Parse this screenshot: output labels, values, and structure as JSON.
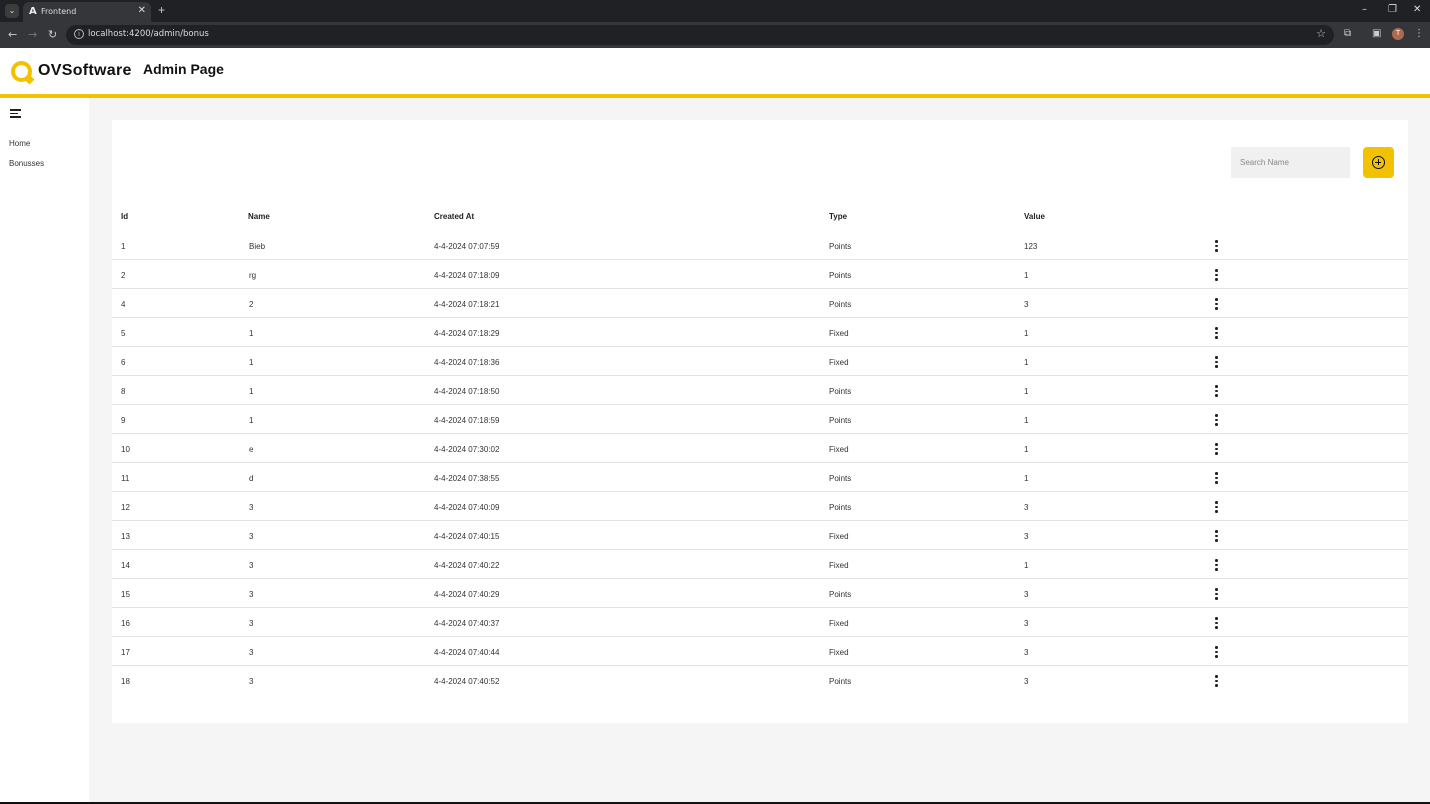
{
  "browser": {
    "tab_title": "Frontend",
    "tab_favicon": "A",
    "url": "localhost:4200/admin/bonus",
    "new_tab_glyph": "+",
    "close_glyph": "✕",
    "icons": [
      "tab-search-icon",
      "back-icon",
      "forward-icon",
      "reload-icon",
      "site-info-icon",
      "bookmark-star-icon",
      "extensions-icon",
      "sidepanel-icon",
      "profile-icon",
      "menu-icon"
    ],
    "profile_initial": "T"
  },
  "header": {
    "logo_text": "OVSoftware",
    "title": "Admin Page"
  },
  "sidebar": {
    "items": [
      {
        "label": "Home"
      },
      {
        "label": "Bonusses"
      }
    ]
  },
  "toolbar": {
    "search_placeholder": "Search Name",
    "search_value": ""
  },
  "table": {
    "headers": {
      "id": "Id",
      "name": "Name",
      "created": "Created At",
      "type": "Type",
      "value": "Value"
    },
    "rows": [
      {
        "id": "1",
        "name": "Bieb",
        "created": "4-4-2024 07:07:59",
        "type": "Points",
        "value": "123"
      },
      {
        "id": "2",
        "name": "rg",
        "created": "4-4-2024 07:18:09",
        "type": "Points",
        "value": "1"
      },
      {
        "id": "4",
        "name": "2",
        "created": "4-4-2024 07:18:21",
        "type": "Points",
        "value": "3"
      },
      {
        "id": "5",
        "name": "1",
        "created": "4-4-2024 07:18:29",
        "type": "Fixed",
        "value": "1"
      },
      {
        "id": "6",
        "name": "1",
        "created": "4-4-2024 07:18:36",
        "type": "Fixed",
        "value": "1"
      },
      {
        "id": "8",
        "name": "1",
        "created": "4-4-2024 07:18:50",
        "type": "Points",
        "value": "1"
      },
      {
        "id": "9",
        "name": "1",
        "created": "4-4-2024 07:18:59",
        "type": "Points",
        "value": "1"
      },
      {
        "id": "10",
        "name": "e",
        "created": "4-4-2024 07:30:02",
        "type": "Fixed",
        "value": "1"
      },
      {
        "id": "11",
        "name": "d",
        "created": "4-4-2024 07:38:55",
        "type": "Points",
        "value": "1"
      },
      {
        "id": "12",
        "name": "3",
        "created": "4-4-2024 07:40:09",
        "type": "Points",
        "value": "3"
      },
      {
        "id": "13",
        "name": "3",
        "created": "4-4-2024 07:40:15",
        "type": "Fixed",
        "value": "3"
      },
      {
        "id": "14",
        "name": "3",
        "created": "4-4-2024 07:40:22",
        "type": "Fixed",
        "value": "1"
      },
      {
        "id": "15",
        "name": "3",
        "created": "4-4-2024 07:40:29",
        "type": "Points",
        "value": "3"
      },
      {
        "id": "16",
        "name": "3",
        "created": "4-4-2024 07:40:37",
        "type": "Fixed",
        "value": "3"
      },
      {
        "id": "17",
        "name": "3",
        "created": "4-4-2024 07:40:44",
        "type": "Fixed",
        "value": "3"
      },
      {
        "id": "18",
        "name": "3",
        "created": "4-4-2024 07:40:52",
        "type": "Points",
        "value": "3"
      }
    ]
  },
  "colors": {
    "accent": "#f2c200",
    "content_bg": "#f5f5f5",
    "chrome_dark": "#202124"
  }
}
